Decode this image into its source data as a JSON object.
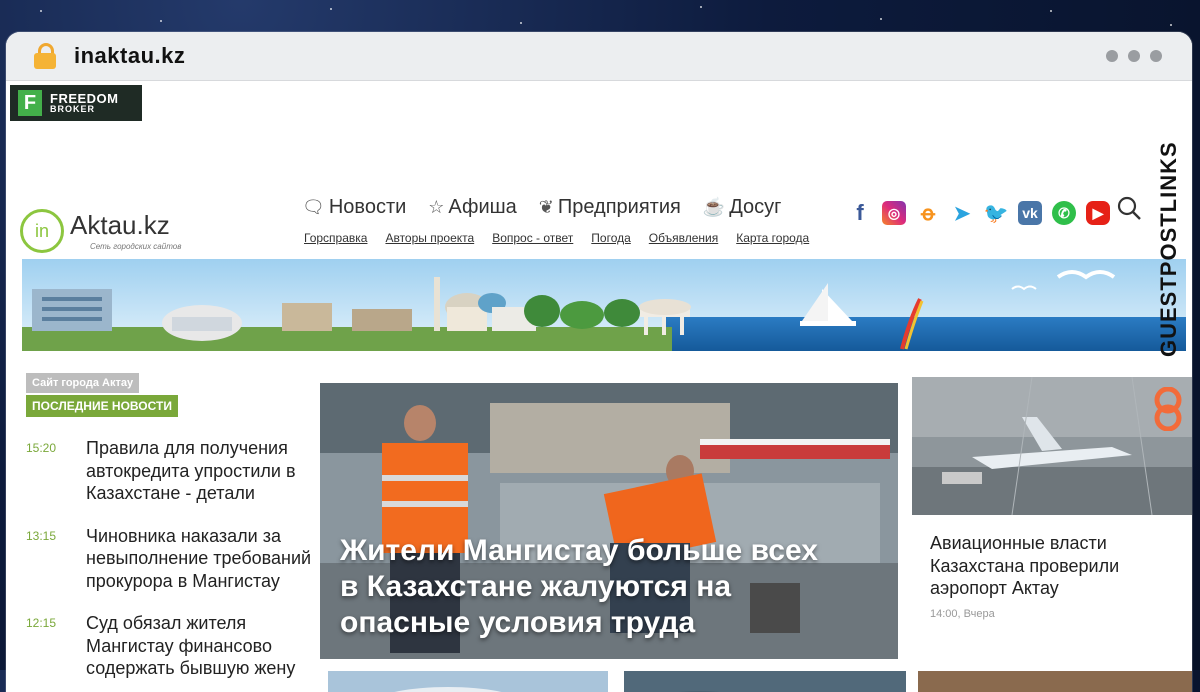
{
  "browser": {
    "url": "inaktau.kz"
  },
  "ad": {
    "brand_line1": "FREEDOM",
    "brand_line2": "BROKER",
    "mark": "F"
  },
  "logo": {
    "circle_text": "in",
    "name": "Aktau.kz",
    "subtitle": "Сеть городских сайтов"
  },
  "main_nav": [
    {
      "label": "Новости",
      "icon": "speech-bubble-icon",
      "glyph": "🗨"
    },
    {
      "label": "Афиша",
      "icon": "star-icon",
      "glyph": "☆"
    },
    {
      "label": "Предприятия",
      "icon": "butterfly-icon",
      "glyph": "❦"
    },
    {
      "label": "Досуг",
      "icon": "cup-icon",
      "glyph": "☕"
    }
  ],
  "sub_nav": [
    "Горсправка",
    "Авторы проекта",
    "Вопрос - ответ",
    "Погода",
    "Объявления",
    "Карта города"
  ],
  "social": [
    {
      "name": "facebook-icon",
      "glyph": "f"
    },
    {
      "name": "instagram-icon",
      "glyph": "◎"
    },
    {
      "name": "odnoklassniki-icon",
      "glyph": "ꝋ"
    },
    {
      "name": "telegram-icon",
      "glyph": "➤"
    },
    {
      "name": "twitter-icon",
      "glyph": "🐦"
    },
    {
      "name": "vk-icon",
      "glyph": "vk"
    },
    {
      "name": "whatsapp-icon",
      "glyph": "✆"
    },
    {
      "name": "youtube-icon",
      "glyph": "▶"
    }
  ],
  "sidebar": {
    "site_tag": "Сайт города Актау",
    "section_tag": "ПОСЛЕДНИЕ НОВОСТИ",
    "items": [
      {
        "time": "15:20",
        "title": "Правила для получения автокредита упростили в Казахстане - детали"
      },
      {
        "time": "13:15",
        "title": "Чиновника наказали за невыполнение требований прокурора в Мангистау"
      },
      {
        "time": "12:15",
        "title": "Суд обязал жителя Мангистау финансово содержать бывшую жену"
      }
    ]
  },
  "feature": {
    "title": "Жители Мангистау больше всех в Казахстане жалуются на опасные условия труда"
  },
  "side_card": {
    "title": "Авиационные власти Казахстана проверили аэропорт Актау",
    "meta": "14:00, Вчера"
  },
  "watermark": {
    "text": "GUESTPOSTLINKS"
  },
  "colors": {
    "accent_green": "#7aa83a",
    "logo_green": "#8cc63f",
    "ad_green": "#43b04a"
  }
}
